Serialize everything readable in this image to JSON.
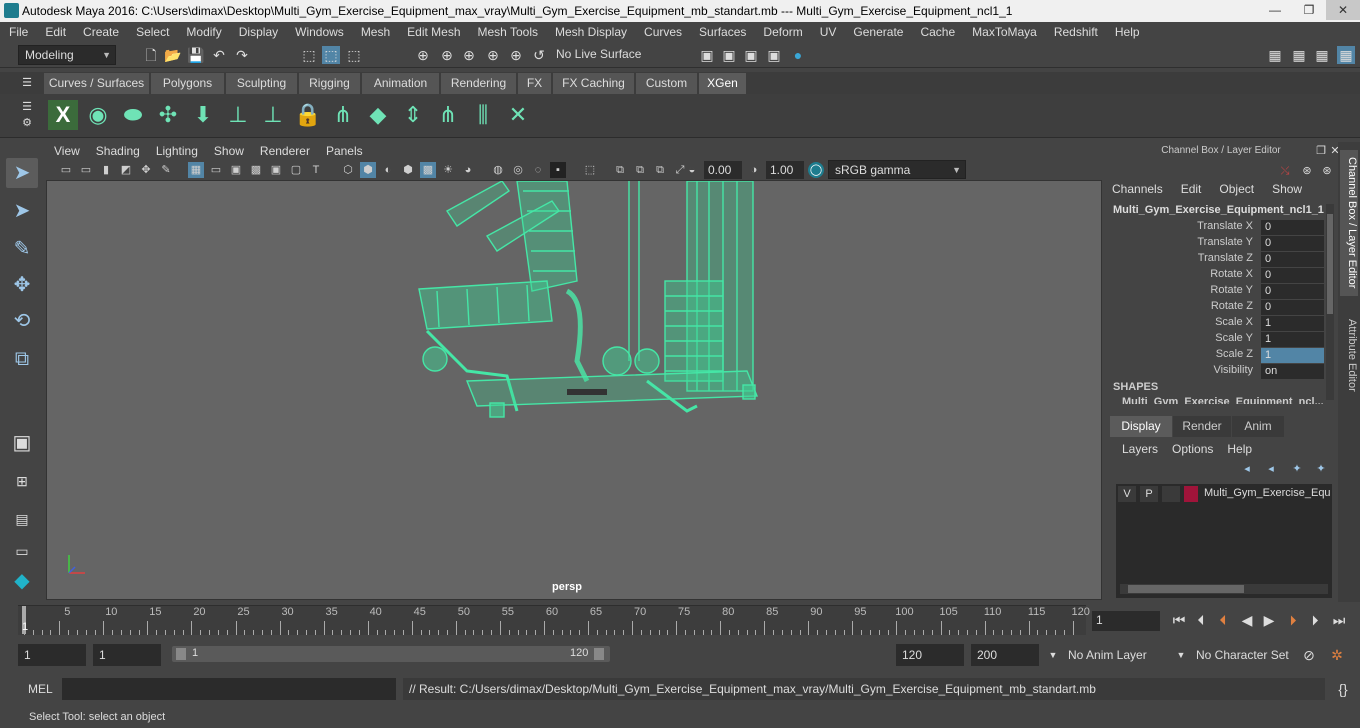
{
  "window": {
    "title": "Autodesk Maya 2016: C:\\Users\\dimax\\Desktop\\Multi_Gym_Exercise_Equipment_max_vray\\Multi_Gym_Exercise_Equipment_mb_standart.mb   ---   Multi_Gym_Exercise_Equipment_ncl1_1",
    "min": "—",
    "max": "❐",
    "close": "✕"
  },
  "menubar": [
    "File",
    "Edit",
    "Create",
    "Select",
    "Modify",
    "Display",
    "Windows",
    "Mesh",
    "Edit Mesh",
    "Mesh Tools",
    "Mesh Display",
    "Curves",
    "Surfaces",
    "Deform",
    "UV",
    "Generate",
    "Cache",
    "MaxToMaya",
    "Redshift",
    "Help"
  ],
  "status": {
    "mode": "Modeling",
    "live_surface": "No Live Surface"
  },
  "shelf_tabs": [
    "Curves / Surfaces",
    "Polygons",
    "Sculpting",
    "Rigging",
    "Animation",
    "Rendering",
    "FX",
    "FX Caching",
    "Custom",
    "XGen"
  ],
  "shelf_active": "XGen",
  "viewport": {
    "menu": [
      "View",
      "Shading",
      "Lighting",
      "Show",
      "Renderer",
      "Panels"
    ],
    "exposure": "0.00",
    "gamma": "1.00",
    "colorspace": "sRGB gamma",
    "camera_label": "persp"
  },
  "channel_box": {
    "title": "Channel Box / Layer Editor",
    "menu": [
      "Channels",
      "Edit",
      "Object",
      "Show"
    ],
    "object": "Multi_Gym_Exercise_Equipment_ncl1_1",
    "attributes": [
      {
        "label": "Translate X",
        "value": "0"
      },
      {
        "label": "Translate Y",
        "value": "0"
      },
      {
        "label": "Translate Z",
        "value": "0"
      },
      {
        "label": "Rotate X",
        "value": "0"
      },
      {
        "label": "Rotate Y",
        "value": "0"
      },
      {
        "label": "Rotate Z",
        "value": "0"
      },
      {
        "label": "Scale X",
        "value": "1"
      },
      {
        "label": "Scale Y",
        "value": "1"
      },
      {
        "label": "Scale Z",
        "value": "1"
      },
      {
        "label": "Visibility",
        "value": "on"
      }
    ],
    "shapes_label": "SHAPES",
    "shape_name": "Multi_Gym_Exercise_Equipment_ncl..."
  },
  "side_tabs": [
    "Channel Box / Layer Editor",
    "Attribute Editor"
  ],
  "layer_editor": {
    "tabs": [
      "Display",
      "Render",
      "Anim"
    ],
    "menu": [
      "Layers",
      "Options",
      "Help"
    ],
    "layer": {
      "v": "V",
      "p": "P",
      "name": "Multi_Gym_Exercise_Equ",
      "color": "#a0143a"
    }
  },
  "timeline": {
    "ticks": [
      5,
      10,
      15,
      20,
      25,
      30,
      35,
      40,
      45,
      50,
      55,
      60,
      65,
      70,
      75,
      80,
      85,
      90,
      95,
      100,
      105,
      110,
      115,
      120
    ],
    "current_frame": "1",
    "current_field": "1"
  },
  "range": {
    "start": "1",
    "playback_start": "1",
    "slider_start": "1",
    "slider_end": "120",
    "playback_end": "120",
    "end": "200",
    "anim_layer": "No Anim Layer",
    "char_set": "No Character Set"
  },
  "command": {
    "lang": "MEL",
    "result": "// Result: C:/Users/dimax/Desktop/Multi_Gym_Exercise_Equipment_max_vray/Multi_Gym_Exercise_Equipment_mb_standart.mb"
  },
  "help_line": "Select Tool: select an object",
  "colors": {
    "wire": "#45e6a6",
    "viewport_bg": "#656565",
    "selection": "#5285a6",
    "accent_teal": "#1e7c8e"
  }
}
